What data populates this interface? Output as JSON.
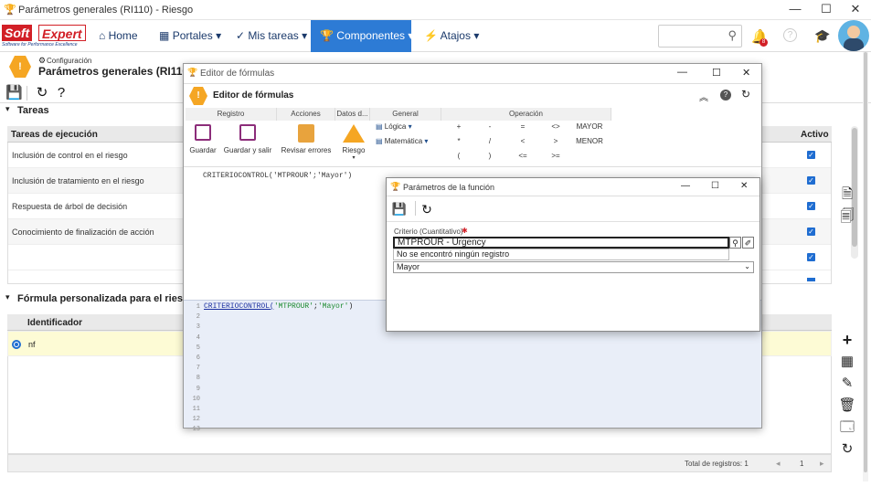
{
  "window": {
    "title": "Parámetros generales (RI110) - Riesgo"
  },
  "nav": {
    "logo_main": "Soft",
    "logo_second": "Expert",
    "logo_tagline": "Software for Performance Excellence",
    "items": [
      {
        "label": "Home"
      },
      {
        "label": "Portales"
      },
      {
        "label": "Mis tareas"
      },
      {
        "label": "Componentes"
      },
      {
        "label": "Atajos"
      }
    ],
    "notification_count": "8"
  },
  "header": {
    "breadcrumb": "Configuración",
    "title": "Parámetros generales (RI110)"
  },
  "tasks": {
    "section_title": "Tareas",
    "col_task": "Tareas de ejecución",
    "col_active": "Activo",
    "rows": [
      {
        "label": "Inclusión de control en el riesgo"
      },
      {
        "label": "Inclusión de tratamiento en el riesgo"
      },
      {
        "label": "Respuesta de árbol de decisión"
      },
      {
        "label": "Conocimiento de finalización de acción"
      },
      {
        "label": ""
      }
    ]
  },
  "formula_section": {
    "title": "Fórmula personalizada para el riesgo re",
    "col_id": "Identificador",
    "row_value": "nf",
    "footer": "Total de registros: 1",
    "page": "1"
  },
  "formula_editor": {
    "window_title": "Editor de fórmulas",
    "header_title": "Editor de fórmulas",
    "groups": {
      "registro": "Registro",
      "acciones": "Acciones",
      "datos": "Datos d...",
      "general": "General",
      "operacion": "Operación"
    },
    "buttons": {
      "guardar": "Guardar",
      "guardar_salir": "Guardar y salir",
      "revisar": "Revisar errores",
      "riesgo": "Riesgo",
      "logica": "Lógica",
      "matematica": "Matemática"
    },
    "operators": [
      "+",
      "-",
      "=",
      "<>",
      "MAYOR",
      "*",
      "/",
      "<",
      ">",
      "MENOR",
      "(",
      ")",
      "<=",
      ">="
    ],
    "preview": "CRITERIOCONTROL('MTPROUR';'Mayor')",
    "code_fn": "CRITERIOCONTROL(",
    "code_arg1": "'MTPROUR'",
    "code_sep": ";",
    "code_arg2": "'Mayor'",
    "code_end": ")",
    "line_numbers": [
      "1",
      "2",
      "3",
      "4",
      "5",
      "6",
      "7",
      "8",
      "9",
      "10",
      "11",
      "12",
      "13"
    ]
  },
  "function_params": {
    "window_title": "Parámetros de la función",
    "criterio_label": "Criterio (Cuantitativo)",
    "criterio_value": "MTPROUR - Urgency",
    "no_record": "No se encontró ningún registro",
    "select_value": "Mayor"
  },
  "colors": {
    "accent": "#2d7bd5",
    "brand": "#d21f26",
    "warning": "#f5a623",
    "highlight_row": "#fdfbd5"
  }
}
